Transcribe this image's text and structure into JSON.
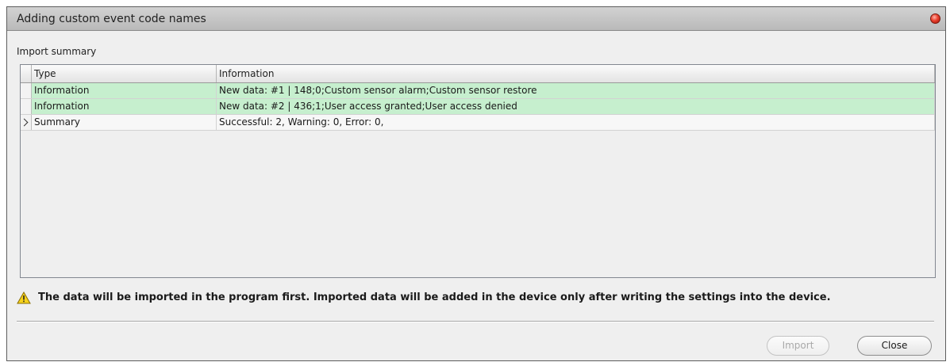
{
  "window": {
    "title": "Adding custom event code names"
  },
  "section": {
    "label": "Import summary"
  },
  "grid": {
    "columns": [
      "Type",
      "Information"
    ],
    "rows": [
      {
        "type": "Information",
        "information": "New data: #1 | 148;0;Custom sensor alarm;Custom sensor restore",
        "highlight": "#c6efce"
      },
      {
        "type": "Information",
        "information": "New data: #2 | 436;1;User access granted;User access denied",
        "highlight": "#c6efce"
      },
      {
        "type": "Summary",
        "information": "Successful: 2, Warning: 0, Error: 0,",
        "current": true
      }
    ]
  },
  "notice": {
    "icon": "warning-icon",
    "text": "The data will be imported in the program first. Imported data will be added in the device only after writing the settings into the device."
  },
  "buttons": {
    "import_label": "Import",
    "import_enabled": false,
    "close_label": "Close"
  }
}
